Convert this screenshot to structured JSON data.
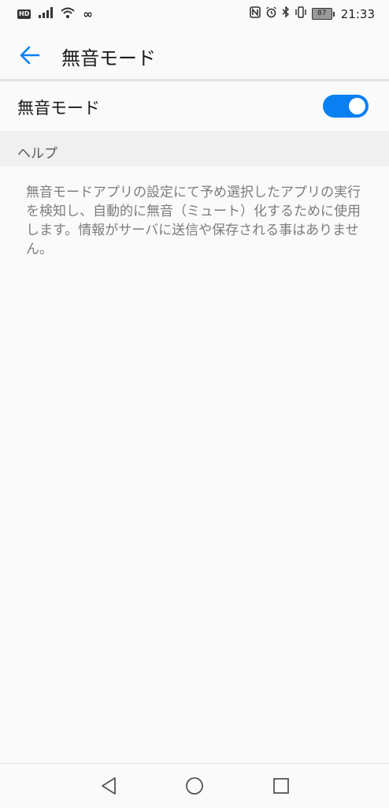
{
  "status_bar": {
    "hd_label": "HD",
    "data_indicator": "∞",
    "battery_level": "87",
    "time": "21:33"
  },
  "app_bar": {
    "title": "無音モード",
    "back_icon": "arrow-back-icon"
  },
  "setting": {
    "label": "無音モード",
    "enabled": true
  },
  "help_section": {
    "title": "ヘルプ",
    "body": "無音モードアプリの設定にて予め選択したアプリの実行を検知し、自動的に無音（ミュート）化するために使用します。情報がサーバに送信や保存される事はありません。"
  },
  "nav_bar": {
    "back_icon": "triangle-back-icon",
    "home_icon": "circle-home-icon",
    "recents_icon": "square-recents-icon"
  },
  "colors": {
    "accent": "#0a7ff2",
    "background": "#fafafa",
    "section_bg": "#f0f0f0",
    "help_text": "#7d7d7d"
  }
}
